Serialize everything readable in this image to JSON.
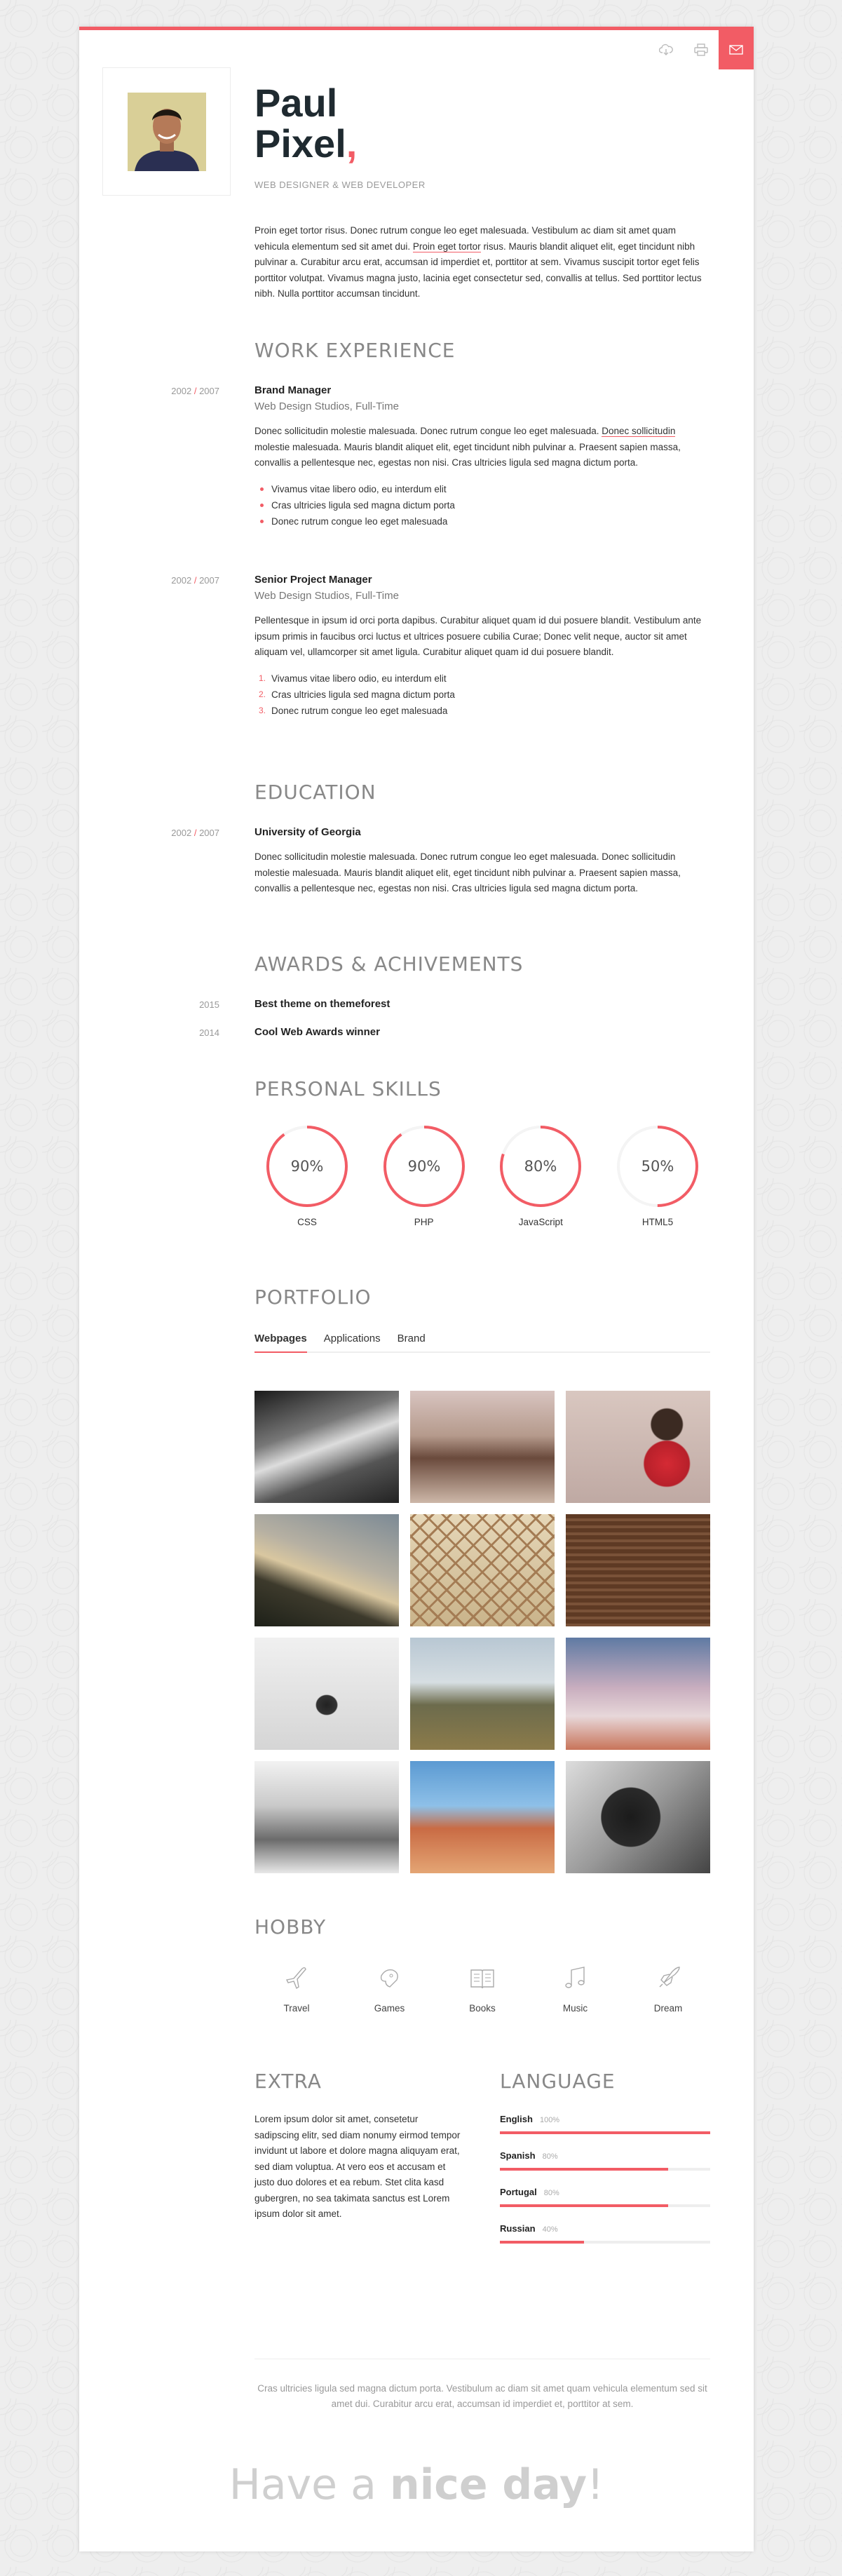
{
  "header": {
    "first_name": "Paul",
    "last_name": "Pixel",
    "comma": ",",
    "role": "WEB DESIGNER & WEB DEVELOPER",
    "intro_a": "Proin eget tortor risus. Donec rutrum congue leo eget malesuada. Vestibulum ac diam sit amet quam vehicula elementum sed sit amet dui. ",
    "intro_link": "Proin eget tortor",
    "intro_b": " risus. Mauris blandit aliquet elit, eget tincidunt nibh pulvinar a. Curabitur arcu erat, accumsan id imperdiet et, porttitor at sem. Vivamus suscipit tortor eget felis porttitor volutpat. Vivamus magna justo, lacinia eget consectetur sed, convallis at tellus. Sed porttitor lectus nibh. Nulla porttitor accumsan tincidunt."
  },
  "toolbar": {
    "download_icon": "cloud-download-icon",
    "print_icon": "print-icon",
    "mail_icon": "mail-icon",
    "accent": "#f25c65"
  },
  "work": {
    "title": "WORK EXPERIENCE",
    "jobs": [
      {
        "from": "2002",
        "sep": "/",
        "to": "2007",
        "title": "Brand Manager",
        "company": "Web Design Studios, Full-Time",
        "desc_a": "Donec sollicitudin molestie malesuada. Donec rutrum congue leo eget malesuada. ",
        "desc_link": "Donec sollicitudin",
        "desc_b": " molestie malesuada. Mauris blandit aliquet elit, eget tincidunt nibh pulvinar a. Praesent sapien massa, convallis a pellentesque nec, egestas non nisi. Cras ultricies ligula sed magna dictum porta.",
        "items": [
          "Vivamus vitae libero odio, eu interdum elit",
          "Cras ultricies ligula sed magna dictum porta",
          "Donec rutrum congue leo eget malesuada"
        ]
      },
      {
        "from": "2002",
        "sep": "/",
        "to": "2007",
        "title": "Senior Project Manager",
        "company": "Web Design Studios, Full-Time",
        "desc": "Pellentesque in ipsum id orci porta dapibus. Curabitur aliquet quam id dui posuere blandit. Vestibulum ante ipsum primis in faucibus orci luctus et ultrices posuere cubilia Curae; Donec velit neque, auctor sit amet aliquam vel, ullamcorper sit amet ligula. Curabitur aliquet quam id dui posuere blandit.",
        "items": [
          "Vivamus vitae libero odio, eu interdum elit",
          "Cras ultricies ligula sed magna dictum porta",
          "Donec rutrum congue leo eget malesuada"
        ],
        "numbers": [
          "1.",
          "2.",
          "3."
        ]
      }
    ]
  },
  "education": {
    "title": "EDUCATION",
    "from": "2002",
    "sep": "/",
    "to": "2007",
    "school": "University of Georgia",
    "desc": "Donec sollicitudin molestie malesuada. Donec rutrum congue leo eget malesuada. Donec sollicitudin molestie malesuada. Mauris blandit aliquet elit, eget tincidunt nibh pulvinar a. Praesent sapien massa, convallis a pellentesque nec, egestas non nisi. Cras ultricies ligula sed magna dictum porta."
  },
  "awards": {
    "title": "AWARDS & ACHIVEMENTS",
    "items": [
      {
        "year": "2015",
        "name": "Best theme on themeforest"
      },
      {
        "year": "2014",
        "name": "Cool Web Awards winner"
      }
    ]
  },
  "skills": {
    "title": "PERSONAL SKILLS",
    "items": [
      {
        "label": "90%",
        "value": 90,
        "name": "CSS"
      },
      {
        "label": "90%",
        "value": 90,
        "name": "PHP"
      },
      {
        "label": "80%",
        "value": 80,
        "name": "JavaScript"
      },
      {
        "label": "50%",
        "value": 50,
        "name": "HTML5"
      }
    ]
  },
  "portfolio": {
    "title": "PORTFOLIO",
    "tabs": [
      "Webpages",
      "Applications",
      "Brand"
    ]
  },
  "hobby": {
    "title": "HOBBY",
    "items": [
      {
        "icon": "plane-icon",
        "label": "Travel"
      },
      {
        "icon": "gamepad-icon",
        "label": "Games"
      },
      {
        "icon": "book-icon",
        "label": "Books"
      },
      {
        "icon": "music-icon",
        "label": "Music"
      },
      {
        "icon": "rocket-icon",
        "label": "Dream"
      }
    ]
  },
  "extra": {
    "title": "EXTRA",
    "text": "Lorem ipsum dolor sit amet, consetetur sadipscing elitr, sed diam nonumy eirmod tempor invidunt ut labore et dolore magna aliquyam erat, sed diam voluptua. At vero eos et accusam et justo duo dolores et ea rebum. Stet clita kasd gubergren, no sea takimata sanctus est Lorem ipsum dolor sit amet."
  },
  "language": {
    "title": "LANGUAGE",
    "items": [
      {
        "name": "English",
        "pct": "100%",
        "value": 100
      },
      {
        "name": "Spanish",
        "pct": "80%",
        "value": 80
      },
      {
        "name": "Portugal",
        "pct": "80%",
        "value": 80
      },
      {
        "name": "Russian",
        "pct": "40%",
        "value": 40
      }
    ]
  },
  "footer": {
    "text": "Cras ultricies ligula sed magna dictum porta. Vestibulum ac diam sit amet quam vehicula elementum sed sit amet dui. Curabitur arcu erat, accumsan id imperdiet et, porttitor at sem.",
    "have_a": "Have a ",
    "nice_day": "nice day",
    "bang": "!"
  }
}
